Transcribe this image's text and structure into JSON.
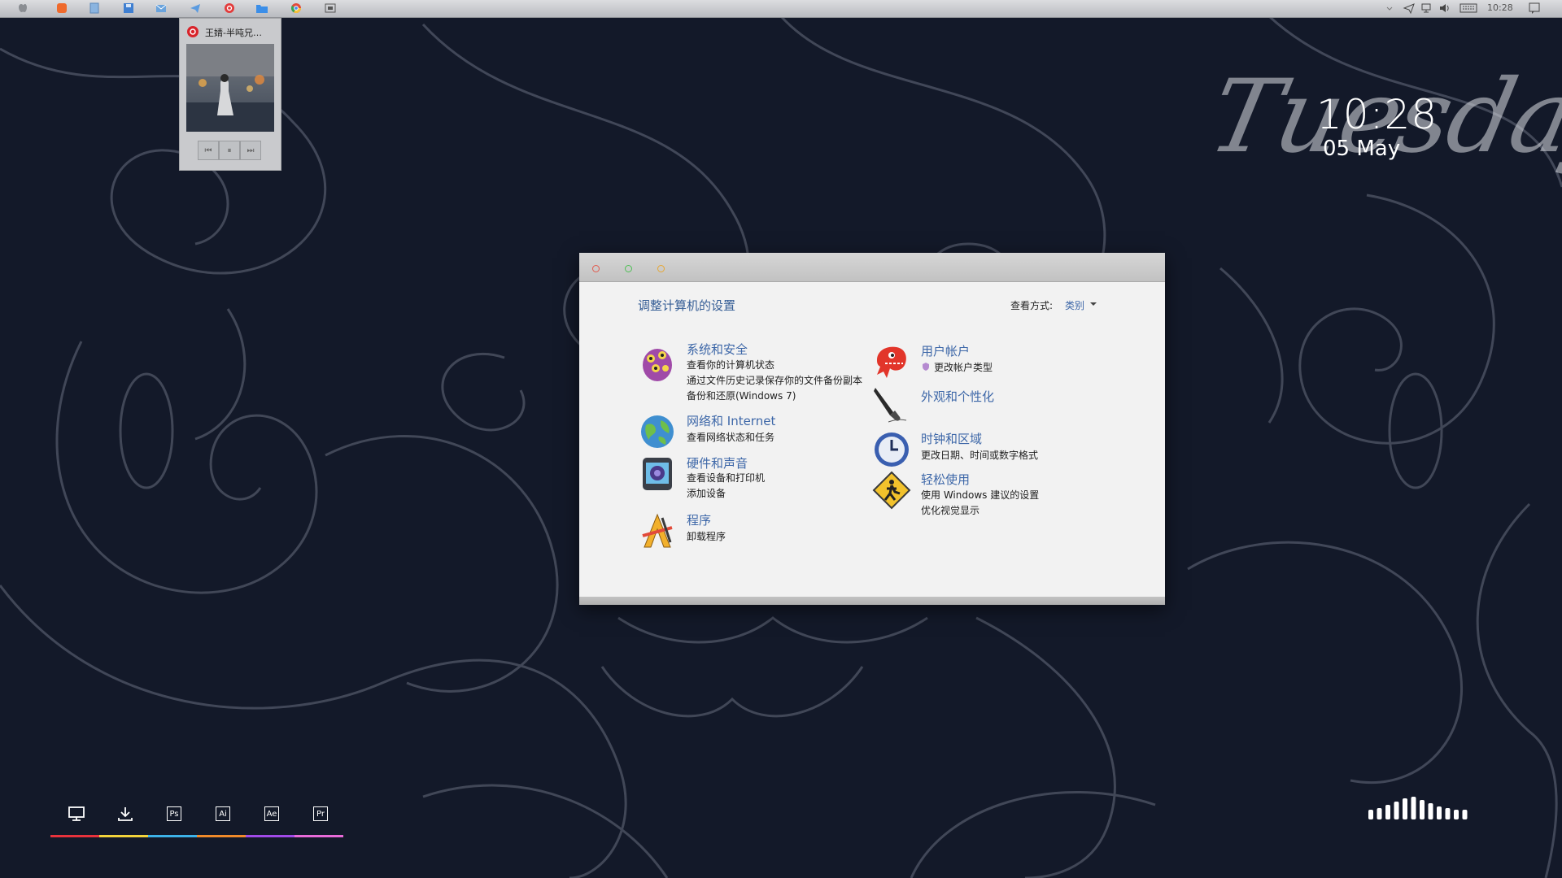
{
  "menubar": {
    "icons": [
      "apple-icon",
      "orange-app-icon",
      "notepad-icon",
      "save-icon",
      "mail-icon",
      "telegram-icon",
      "netease-music-icon",
      "folder-icon",
      "chrome-icon",
      "window-icon"
    ],
    "tray_icons": [
      "chevron-down-icon",
      "send-icon",
      "network-icon",
      "volume-icon",
      "keyboard-icon"
    ],
    "clock": "10:28",
    "notification_icon": "notification-icon"
  },
  "music_widget": {
    "title": "王婧-半吨兄…",
    "app_icon": "netease-music-icon",
    "controls": [
      "previous-icon",
      "pause-icon",
      "next-icon"
    ]
  },
  "desktop_clock": {
    "day": "Tuesday",
    "time": "10:28",
    "date": "05 May"
  },
  "control_panel": {
    "heading": "调整计算机的设置",
    "view_by_label": "查看方式:",
    "view_by_value": "类别",
    "categories_left": [
      {
        "title": "系统和安全",
        "icon": "system-security-icon",
        "links": [
          "查看你的计算机状态",
          "通过文件历史记录保存你的文件备份副本",
          "备份和还原(Windows 7)"
        ]
      },
      {
        "title": "网络和 Internet",
        "icon": "network-globe-icon",
        "links": [
          "查看网络状态和任务"
        ]
      },
      {
        "title": "硬件和声音",
        "icon": "hardware-sound-icon",
        "links": [
          "查看设备和打印机",
          "添加设备"
        ]
      },
      {
        "title": "程序",
        "icon": "programs-icon",
        "links": [
          "卸载程序"
        ]
      }
    ],
    "categories_right": [
      {
        "title": "用户帐户",
        "icon": "user-accounts-icon",
        "links": [
          "更改帐户类型"
        ]
      },
      {
        "title": "外观和个性化",
        "icon": "appearance-pen-icon",
        "links": []
      },
      {
        "title": "时钟和区域",
        "icon": "clock-region-icon",
        "links": [
          "更改日期、时间或数字格式"
        ]
      },
      {
        "title": "轻松使用",
        "icon": "ease-of-access-icon",
        "links": [
          "使用 Windows 建议的设置",
          "优化视觉显示"
        ]
      }
    ]
  },
  "dock": {
    "items": [
      {
        "name": "desktop",
        "icon": "monitor-icon",
        "label": ""
      },
      {
        "name": "downloads",
        "icon": "download-icon",
        "label": ""
      },
      {
        "name": "photoshop",
        "icon": "photoshop-icon",
        "label": "Ps"
      },
      {
        "name": "illustrator",
        "icon": "illustrator-icon",
        "label": "Ai"
      },
      {
        "name": "after-effects",
        "icon": "after-effects-icon",
        "label": "Ae"
      },
      {
        "name": "premiere",
        "icon": "premiere-icon",
        "label": "Pr"
      }
    ],
    "underline_colors": [
      "#e8323c",
      "#f2d33b",
      "#3db2e8",
      "#f08a2a",
      "#a04ae8",
      "#e86ad8"
    ]
  },
  "colors": {
    "background": "#131929",
    "ornament": "#4a5060",
    "window_bg": "#f2f2f2",
    "link_blue": "#3d67a8"
  }
}
